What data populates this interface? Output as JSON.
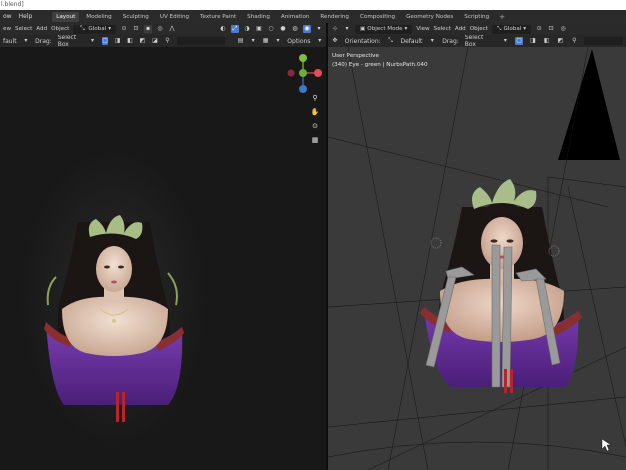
{
  "window": {
    "title": "l.blend]"
  },
  "menubar": {
    "items": [
      "ow",
      "Help"
    ],
    "tabs": [
      {
        "label": "Layout",
        "active": true
      },
      {
        "label": "Modeling"
      },
      {
        "label": "Sculpting"
      },
      {
        "label": "UV Editing"
      },
      {
        "label": "Texture Paint"
      },
      {
        "label": "Shading"
      },
      {
        "label": "Animation"
      },
      {
        "label": "Rendering"
      },
      {
        "label": "Compositing"
      },
      {
        "label": "Geometry Nodes"
      },
      {
        "label": "Scripting"
      }
    ],
    "add_tab": "+"
  },
  "left_header": {
    "menu": [
      "ew",
      "Select",
      "Add",
      "Object"
    ],
    "transform_orientation": "Global",
    "mode2": "fault",
    "drag_label": "Drag:",
    "drag_value": "Select Box",
    "options": "Options"
  },
  "right_header": {
    "mode": "Object Mode",
    "menu": [
      "View",
      "Select",
      "Add",
      "Object"
    ],
    "transform_orientation": "Global",
    "orientation_label": "Orientation:",
    "orientation_value": "Default",
    "drag_label": "Drag:",
    "drag_value": "Select Box"
  },
  "right_viewport": {
    "perspective": "User Perspective",
    "object_info": "(340) Eye - green | NurbsPath.040"
  },
  "gizmo": {
    "x_label": "X",
    "y_label": "Y",
    "z_label": "Z",
    "x_color": "#e84b5a",
    "y_color": "#7fbf3a",
    "z_color": "#3f78c8"
  },
  "colors": {
    "accent": "#4a7bd1",
    "viewport_bg_left": "#181818",
    "viewport_bg_right": "#3a3a3a",
    "robe": "#6a2fa0",
    "skin": "#e8d3c4"
  }
}
